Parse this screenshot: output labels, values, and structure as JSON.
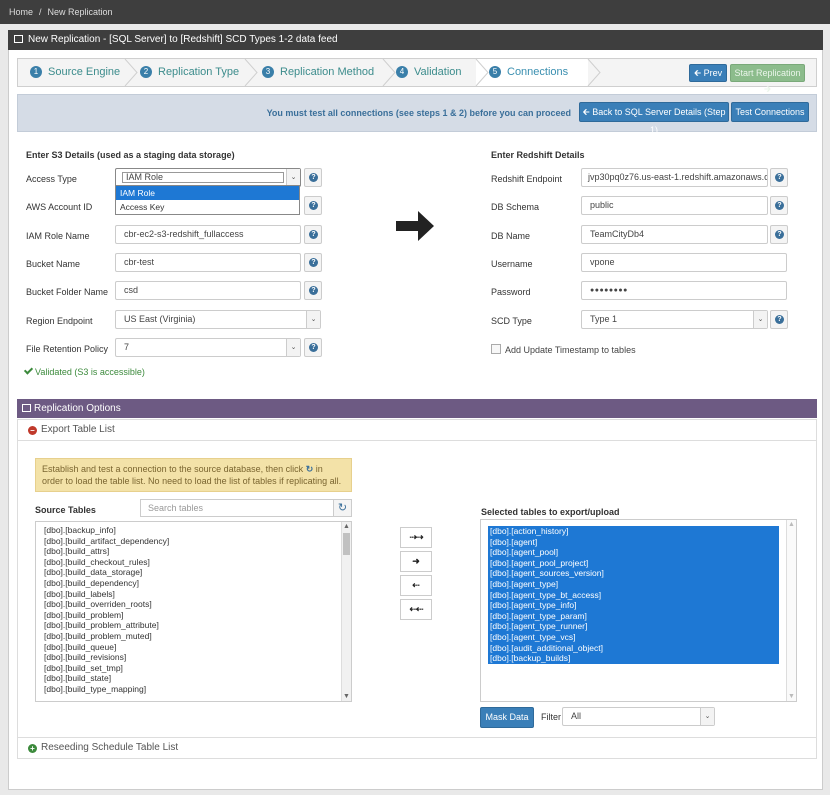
{
  "breadcrumb": {
    "home": "Home",
    "sep": "/",
    "current": "New Replication"
  },
  "header": {
    "title": "New Replication - [SQL Server] to [Redshift] SCD Types 1-2 data feed"
  },
  "wizard": {
    "steps": [
      {
        "num": "1",
        "label": "Source Engine"
      },
      {
        "num": "2",
        "label": "Replication Type"
      },
      {
        "num": "3",
        "label": "Replication Method"
      },
      {
        "num": "4",
        "label": "Validation"
      },
      {
        "num": "5",
        "label": "Connections"
      }
    ],
    "prev_label": "Prev",
    "start_label": "Start Replication"
  },
  "infobar": {
    "message": "You must test all connections (see steps 1 & 2) before you can proceed",
    "back_label": "Back to SQL Server Details (Step 1)",
    "test_label": "Test Connections"
  },
  "s3": {
    "heading": "Enter S3 Details (used as a staging data storage)",
    "access_type_label": "Access Type",
    "access_type_value": "IAM Role",
    "access_type_options": [
      "IAM Role",
      "Access Key"
    ],
    "account_label": "AWS Account ID",
    "iam_label": "IAM Role Name",
    "iam_value": "cbr-ec2-s3-redshift_fullaccess",
    "bucket_label": "Bucket Name",
    "bucket_value": "cbr-test",
    "folder_label": "Bucket Folder Name",
    "folder_value": "csd",
    "region_label": "Region Endpoint",
    "region_value": "US East (Virginia)",
    "retention_label": "File Retention Policy",
    "retention_value": "7",
    "validated": "Validated (S3 is accessible)"
  },
  "redshift": {
    "heading": "Enter Redshift Details",
    "endpoint_label": "Redshift Endpoint",
    "endpoint_value": "jvp30pq0z76.us-east-1.redshift.amazonaws.cor",
    "schema_label": "DB Schema",
    "schema_value": "public",
    "dbname_label": "DB Name",
    "dbname_value": "TeamCityDb4",
    "username_label": "Username",
    "username_value": "vpone",
    "password_label": "Password",
    "password_value": "●●●●●●●●",
    "scd_label": "SCD Type",
    "scd_value": "Type 1",
    "timestamp_label": "Add Update Timestamp to tables"
  },
  "options": {
    "title": "Replication Options",
    "export_label": "Export Table List",
    "notice_1": "Establish and test a connection to the source database, then click",
    "notice_2": "in order to load the table list. No need to load the list of tables if replicating all.",
    "source_title": "Source Tables",
    "search_placeholder": "Search tables",
    "selected_title": "Selected tables to export/upload",
    "mask_label": "Mask Data",
    "filter_label": "Filter",
    "filter_value": "All",
    "reseed_label": "Reseeding Schedule Table List"
  },
  "source_tables": [
    "[dbo].[backup_info]",
    "[dbo].[build_artifact_dependency]",
    "[dbo].[build_attrs]",
    "[dbo].[build_checkout_rules]",
    "[dbo].[build_data_storage]",
    "[dbo].[build_dependency]",
    "[dbo].[build_labels]",
    "[dbo].[build_overriden_roots]",
    "[dbo].[build_problem]",
    "[dbo].[build_problem_attribute]",
    "[dbo].[build_problem_muted]",
    "[dbo].[build_queue]",
    "[dbo].[build_revisions]",
    "[dbo].[build_set_tmp]",
    "[dbo].[build_state]",
    "[dbo].[build_type_mapping]"
  ],
  "selected_tables": [
    "[dbo].[action_history]",
    "[dbo].[agent]",
    "[dbo].[agent_pool]",
    "[dbo].[agent_pool_project]",
    "[dbo].[agent_sources_version]",
    "[dbo].[agent_type]",
    "[dbo].[agent_type_bt_access]",
    "[dbo].[agent_type_info]",
    "[dbo].[agent_type_param]",
    "[dbo].[agent_type_runner]",
    "[dbo].[agent_type_vcs]",
    "[dbo].[audit_additional_object]",
    "[dbo].[backup_builds]"
  ],
  "move_buttons": {
    "all_right": "⇢⇢",
    "one_right": "➜",
    "one_left": "⇠",
    "all_left": "⇠⇠"
  }
}
